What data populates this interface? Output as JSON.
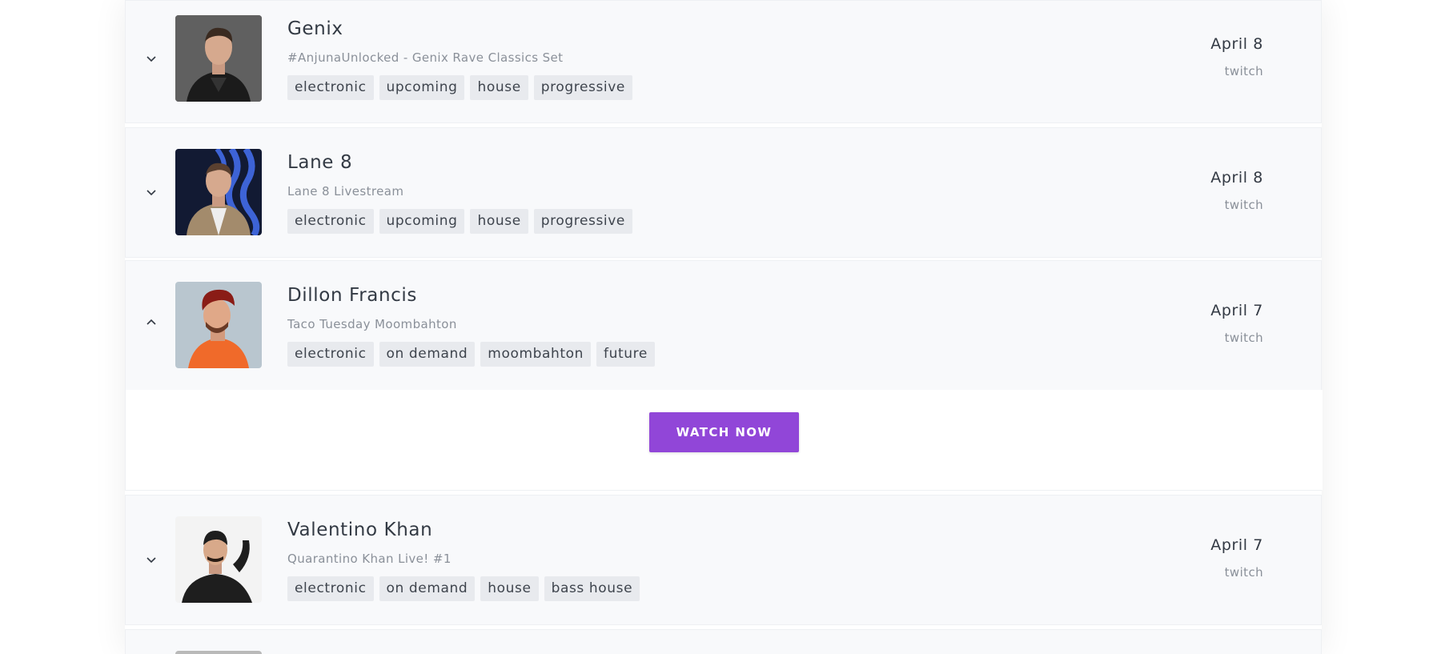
{
  "streams": [
    {
      "artist": "Genix",
      "event": "#AnjunaUnlocked - Genix Rave Classics Set",
      "tags": [
        "electronic",
        "upcoming",
        "house",
        "progressive"
      ],
      "date": "April 8",
      "platform": "twitch",
      "expanded": false,
      "avatar_icon": "artist-photo-icon"
    },
    {
      "artist": "Lane 8",
      "event": "Lane 8 Livestream",
      "tags": [
        "electronic",
        "upcoming",
        "house",
        "progressive"
      ],
      "date": "April 8",
      "platform": "twitch",
      "expanded": false,
      "avatar_icon": "artist-photo-icon"
    },
    {
      "artist": "Dillon Francis",
      "event": "Taco Tuesday Moombahton",
      "tags": [
        "electronic",
        "on demand",
        "moombahton",
        "future"
      ],
      "date": "April 7",
      "platform": "twitch",
      "expanded": true,
      "avatar_icon": "artist-photo-icon"
    },
    {
      "artist": "Valentino Khan",
      "event": "Quarantino Khan Live! #1",
      "tags": [
        "electronic",
        "on demand",
        "house",
        "bass house"
      ],
      "date": "April 7",
      "platform": "twitch",
      "expanded": false,
      "avatar_icon": "artist-photo-icon"
    }
  ],
  "watch_button_label": "WATCH NOW",
  "colors": {
    "accent": "#9146d8",
    "card_bg": "#f8f9fb",
    "tag_bg": "#e8eaee",
    "text": "#333a44",
    "muted": "#8a9099"
  }
}
